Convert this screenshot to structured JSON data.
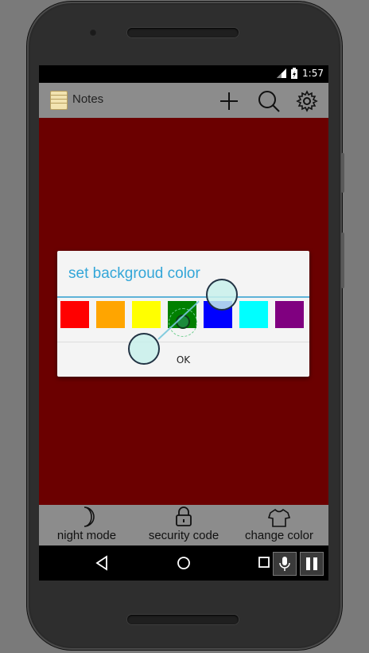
{
  "status_bar": {
    "time": "1:57"
  },
  "app_bar": {
    "title": "Notes",
    "add_icon": "plus-icon",
    "search_icon": "search-icon",
    "settings_icon": "gear-icon"
  },
  "dialog": {
    "title": "set backgroud color",
    "swatches": [
      {
        "name": "red",
        "color": "#ff0000"
      },
      {
        "name": "orange",
        "color": "#ffa500"
      },
      {
        "name": "yellow",
        "color": "#ffff00"
      },
      {
        "name": "green",
        "color": "#008000",
        "selected": true
      },
      {
        "name": "blue",
        "color": "#0000ff"
      },
      {
        "name": "cyan",
        "color": "#00ffff"
      },
      {
        "name": "purple",
        "color": "#800080"
      }
    ],
    "ok_label": "OK"
  },
  "bottom_bar": {
    "night_mode": "night mode",
    "security_code": "security code",
    "change_color": "change color"
  },
  "colors": {
    "background": "#6b0000",
    "toolbar": "#8c8c8c",
    "accent": "#33a6d8"
  }
}
